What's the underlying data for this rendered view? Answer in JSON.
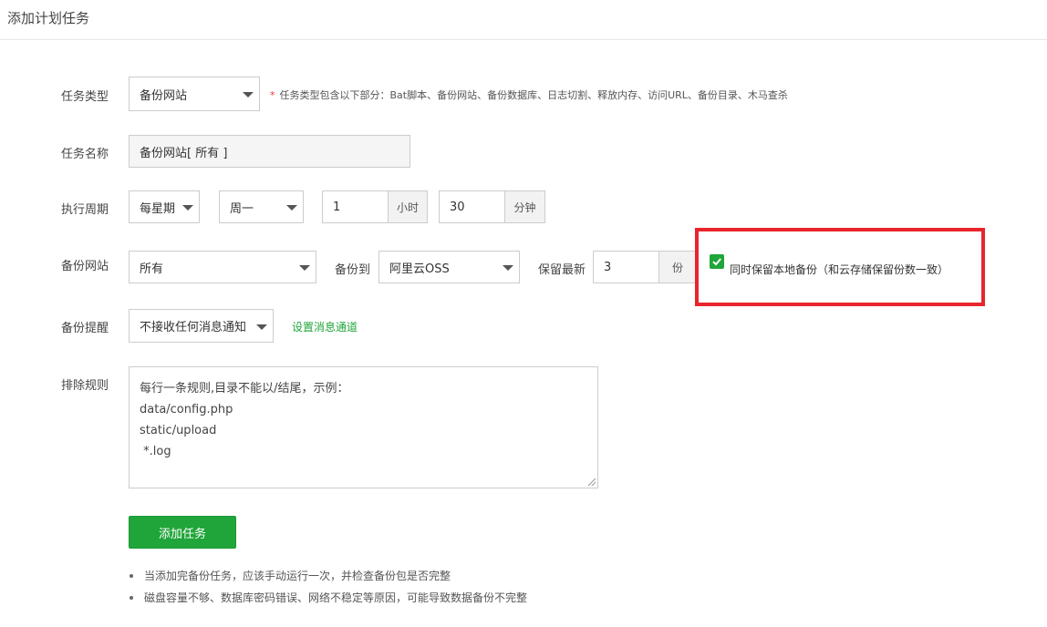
{
  "header": {
    "title": "添加计划任务"
  },
  "task_type": {
    "label": "任务类型",
    "value": "备份网站",
    "hint_star": "*",
    "hint": "任务类型包含以下部分：Bat脚本、备份网站、备份数据库、日志切割、释放内存、访问URL、备份目录、木马查杀"
  },
  "task_name": {
    "label": "任务名称",
    "value": "备份网站[ 所有 ]"
  },
  "schedule": {
    "label": "执行周期",
    "period": "每星期",
    "weekday": "周一",
    "hour": "1",
    "hour_unit": "小时",
    "minute": "30",
    "minute_unit": "分钟"
  },
  "backup_site": {
    "label": "备份网站",
    "value": "所有",
    "target_label": "备份到",
    "target_value": "阿里云OSS",
    "keep_label": "保留最新",
    "keep_value": "3",
    "keep_unit": "份",
    "keep_local_checked": true,
    "keep_local_label": "同时保留本地备份（和云存储保留份数一致）"
  },
  "notify": {
    "label": "备份提醒",
    "value": "不接收任何消息通知",
    "link": "设置消息通道"
  },
  "exclude": {
    "label": "排除规则",
    "lines": [
      "每行一条规则,目录不能以/结尾，示例：",
      "data/config.php",
      "static/upload",
      " *.log"
    ]
  },
  "submit": {
    "label": "添加任务"
  },
  "notes": [
    "当添加完备份任务，应该手动运行一次，并检查备份包是否完整",
    "磁盘容量不够、数据库密码错误、网络不稳定等原因，可能导致数据备份不完整"
  ],
  "colors": {
    "accent": "#20a53a",
    "highlight": "#e8252b"
  }
}
